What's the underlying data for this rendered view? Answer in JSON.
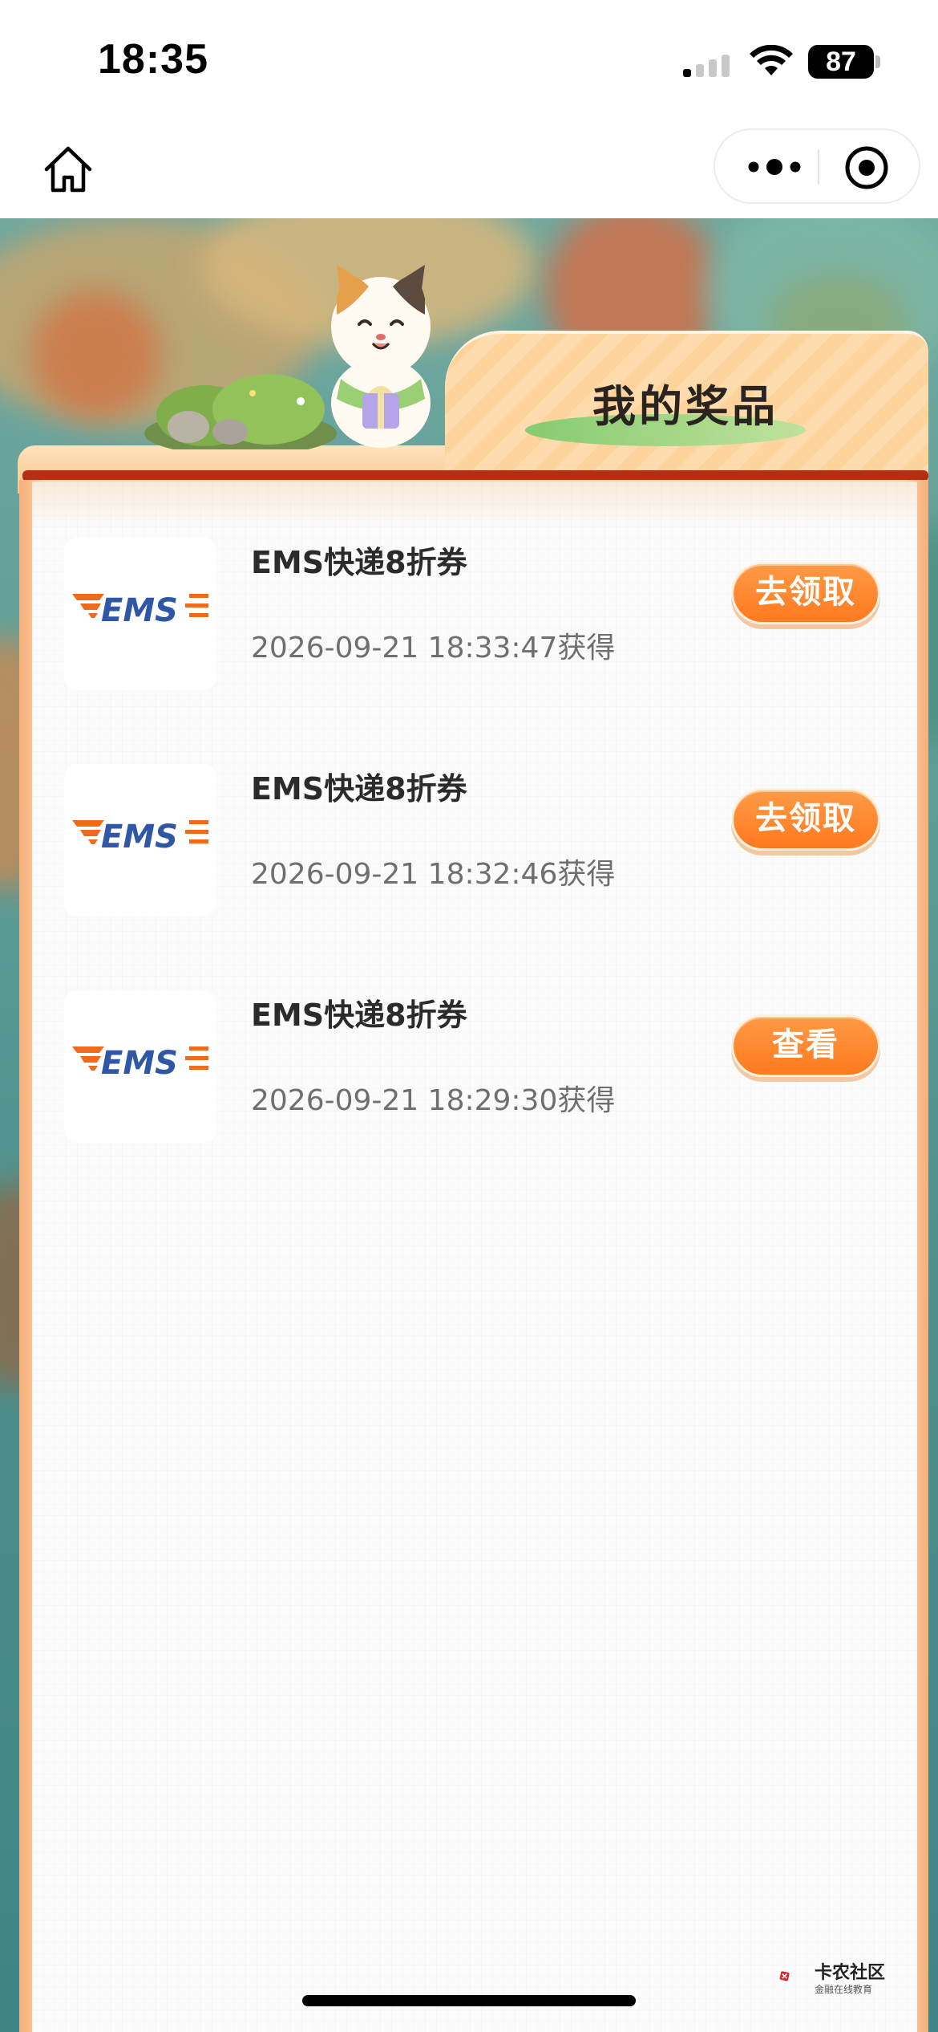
{
  "status_bar": {
    "time": "18:35",
    "battery": "87"
  },
  "nav": {
    "home_icon": "home-icon",
    "more_icon": "more-dots-icon",
    "close_icon": "target-close-icon"
  },
  "header": {
    "title": "我的奖品"
  },
  "prizes": [
    {
      "logo_text": "EMS",
      "title": "EMS快递8折券",
      "time": "2026-09-21 18:33:47获得",
      "action": "去领取"
    },
    {
      "logo_text": "EMS",
      "title": "EMS快递8折券",
      "time": "2026-09-21 18:32:46获得",
      "action": "去领取"
    },
    {
      "logo_text": "EMS",
      "title": "EMS快递8折券",
      "time": "2026-09-21 18:29:30获得",
      "action": "查看"
    }
  ],
  "watermark": {
    "title": "卡农社区",
    "subtitle": "金融在线教育"
  },
  "colors": {
    "button_orange": "#ff7a1f",
    "ems_orange": "#ee6a1c",
    "ems_blue": "#2f57a6",
    "rail_red": "#b82d12"
  }
}
